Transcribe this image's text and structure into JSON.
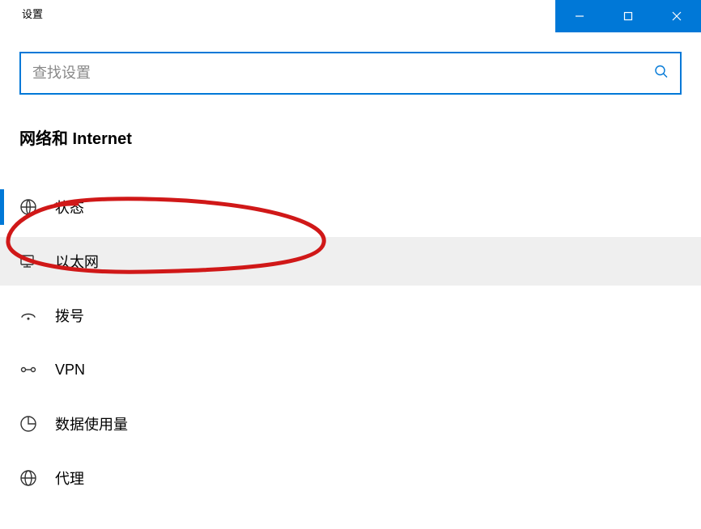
{
  "window": {
    "title": "设置"
  },
  "search": {
    "placeholder": "查找设置"
  },
  "page": {
    "title": "网络和 Internet"
  },
  "nav": {
    "items": [
      {
        "icon": "globe-status-icon",
        "label": "状态",
        "active_indicator": true,
        "selected": false
      },
      {
        "icon": "ethernet-icon",
        "label": "以太网",
        "active_indicator": false,
        "selected": true
      },
      {
        "icon": "dialup-icon",
        "label": "拨号",
        "active_indicator": false,
        "selected": false
      },
      {
        "icon": "vpn-icon",
        "label": "VPN",
        "active_indicator": false,
        "selected": false
      },
      {
        "icon": "data-usage-icon",
        "label": "数据使用量",
        "active_indicator": false,
        "selected": false
      },
      {
        "icon": "proxy-icon",
        "label": "代理",
        "active_indicator": false,
        "selected": false
      }
    ]
  },
  "annotation": {
    "color": "#d01818"
  }
}
